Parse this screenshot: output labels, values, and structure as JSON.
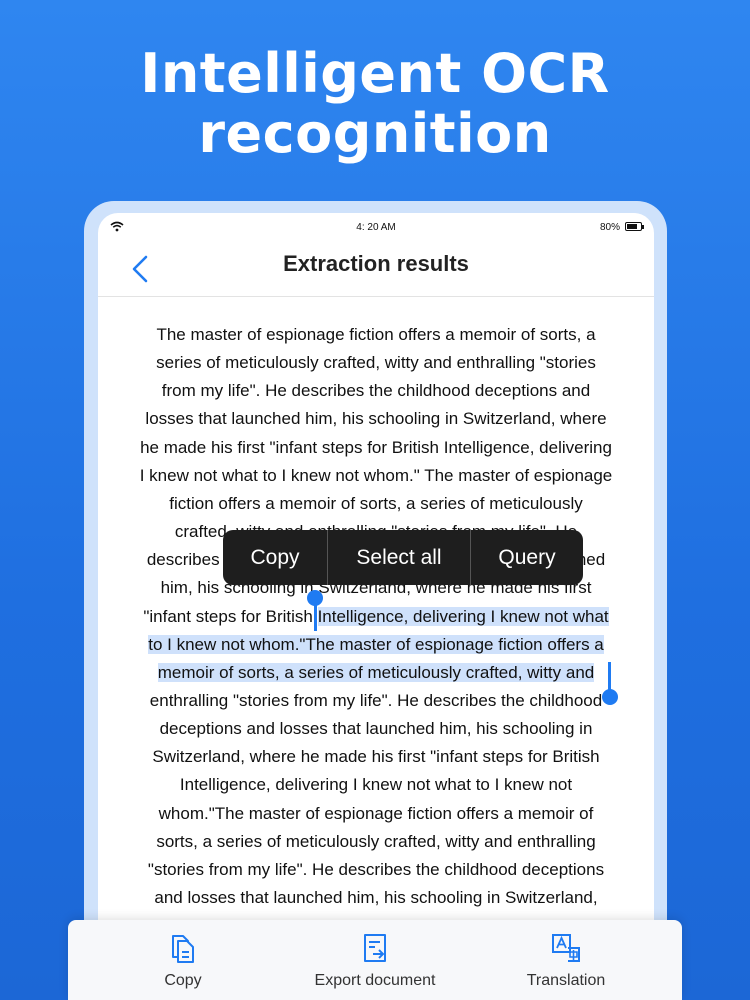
{
  "headline": {
    "line1": "Intelligent OCR",
    "line2": "recognition"
  },
  "status_bar": {
    "time": "4: 20 AM",
    "battery": "80%",
    "battery_level": 0.8
  },
  "nav": {
    "title": "Extraction results"
  },
  "document": {
    "lines": [
      {
        "text": "The master of espionage fiction offers a memoir of sorts, a"
      },
      {
        "text": "series of meticulously crafted, witty and enthralling \"stories"
      },
      {
        "text": "from my life\". He describes the childhood deceptions and"
      },
      {
        "text": "losses that launched him, his schooling in Switzerland, where"
      },
      {
        "text": "he made his first \"infant steps for British Intelligence, delivering"
      },
      {
        "text": "I knew not what to I knew not whom.\" The master of espionage"
      },
      {
        "text": "fiction offers a memoir of sorts, a series of meticulously"
      },
      {
        "text": "crafted, witty and enthralling \"stories from my life\". He"
      },
      {
        "text": "describes the childhood deceptions and losses that launched"
      },
      {
        "text": "him, his schooling in Switzerland, where he made his first"
      },
      {
        "before": "\"infant steps for British ",
        "selected": "Intelligence, delivering I knew not what"
      },
      {
        "selected": "to I knew not whom.\"The master of espionage fiction offers a"
      },
      {
        "selected": "memoir of sorts, a series of meticulously crafted, witty and"
      },
      {
        "text": "enthralling \"stories from my life\". He describes the childhood"
      },
      {
        "text": "deceptions and losses that launched him, his schooling in"
      },
      {
        "text": "Switzerland, where he made his first \"infant steps for British"
      },
      {
        "text": "Intelligence, delivering I knew not what to I knew not"
      },
      {
        "text": "whom.\"The master of espionage fiction offers a memoir of"
      },
      {
        "text": "sorts, a series of meticulously crafted, witty and enthralling"
      },
      {
        "text": "\"stories from my life\". He describes the childhood deceptions"
      },
      {
        "text": "and losses that launched him, his schooling in Switzerland,"
      }
    ]
  },
  "context_menu": {
    "copy": "Copy",
    "select_all": "Select all",
    "query": "Query"
  },
  "toolbar": {
    "copy": "Copy",
    "export": "Export document",
    "translation": "Translation"
  },
  "colors": {
    "accent": "#1f7bf2",
    "selection": "#cfe1fb",
    "background": "#2f86f0"
  },
  "icons": {
    "copy": "copy-icon",
    "export": "export-document-icon",
    "translation": "translation-icon",
    "back": "chevron-left-icon"
  }
}
